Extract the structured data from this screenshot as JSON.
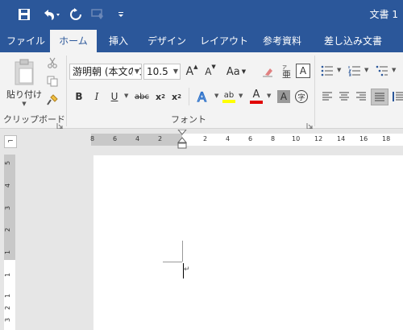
{
  "title_bar": {
    "doc_title": "文書 1",
    "qat": [
      "save-icon",
      "undo-icon",
      "redo-icon",
      "touch-mode-icon",
      "customize-qat-icon"
    ]
  },
  "tabs": [
    {
      "label": "ファイル",
      "active": false
    },
    {
      "label": "ホーム",
      "active": true
    },
    {
      "label": "挿入",
      "active": false
    },
    {
      "label": "デザイン",
      "active": false
    },
    {
      "label": "レイアウト",
      "active": false
    },
    {
      "label": "参考資料",
      "active": false
    },
    {
      "label": "差し込み文書",
      "active": false
    }
  ],
  "clipboard": {
    "paste_label": "貼り付け",
    "group_label": "クリップボード"
  },
  "font": {
    "font_name": "游明朝 (本文のフォント",
    "font_size": "10.5",
    "group_label": "フォント",
    "case_label": "Aa",
    "bold": "B",
    "italic": "I",
    "underline": "U",
    "strikethrough": "abc",
    "subscript": "x",
    "subscript_2": "2",
    "superscript": "x",
    "superscript_2": "2",
    "enclose_char": "字"
  },
  "ruler": {
    "h_ticks": [
      "8",
      "6",
      "4",
      "2",
      "2",
      "4",
      "6",
      "8",
      "10",
      "12",
      "14",
      "16",
      "18"
    ],
    "v_ticks": [
      "5",
      "4",
      "3",
      "2",
      "1",
      "1",
      "1",
      "2",
      "3"
    ],
    "corner_glyph": "⌐"
  },
  "document": {
    "paragraph_mark": "↵"
  },
  "colors": {
    "brand": "#2b579a",
    "highlight": "#ffff00",
    "font_color": "#e00000"
  }
}
